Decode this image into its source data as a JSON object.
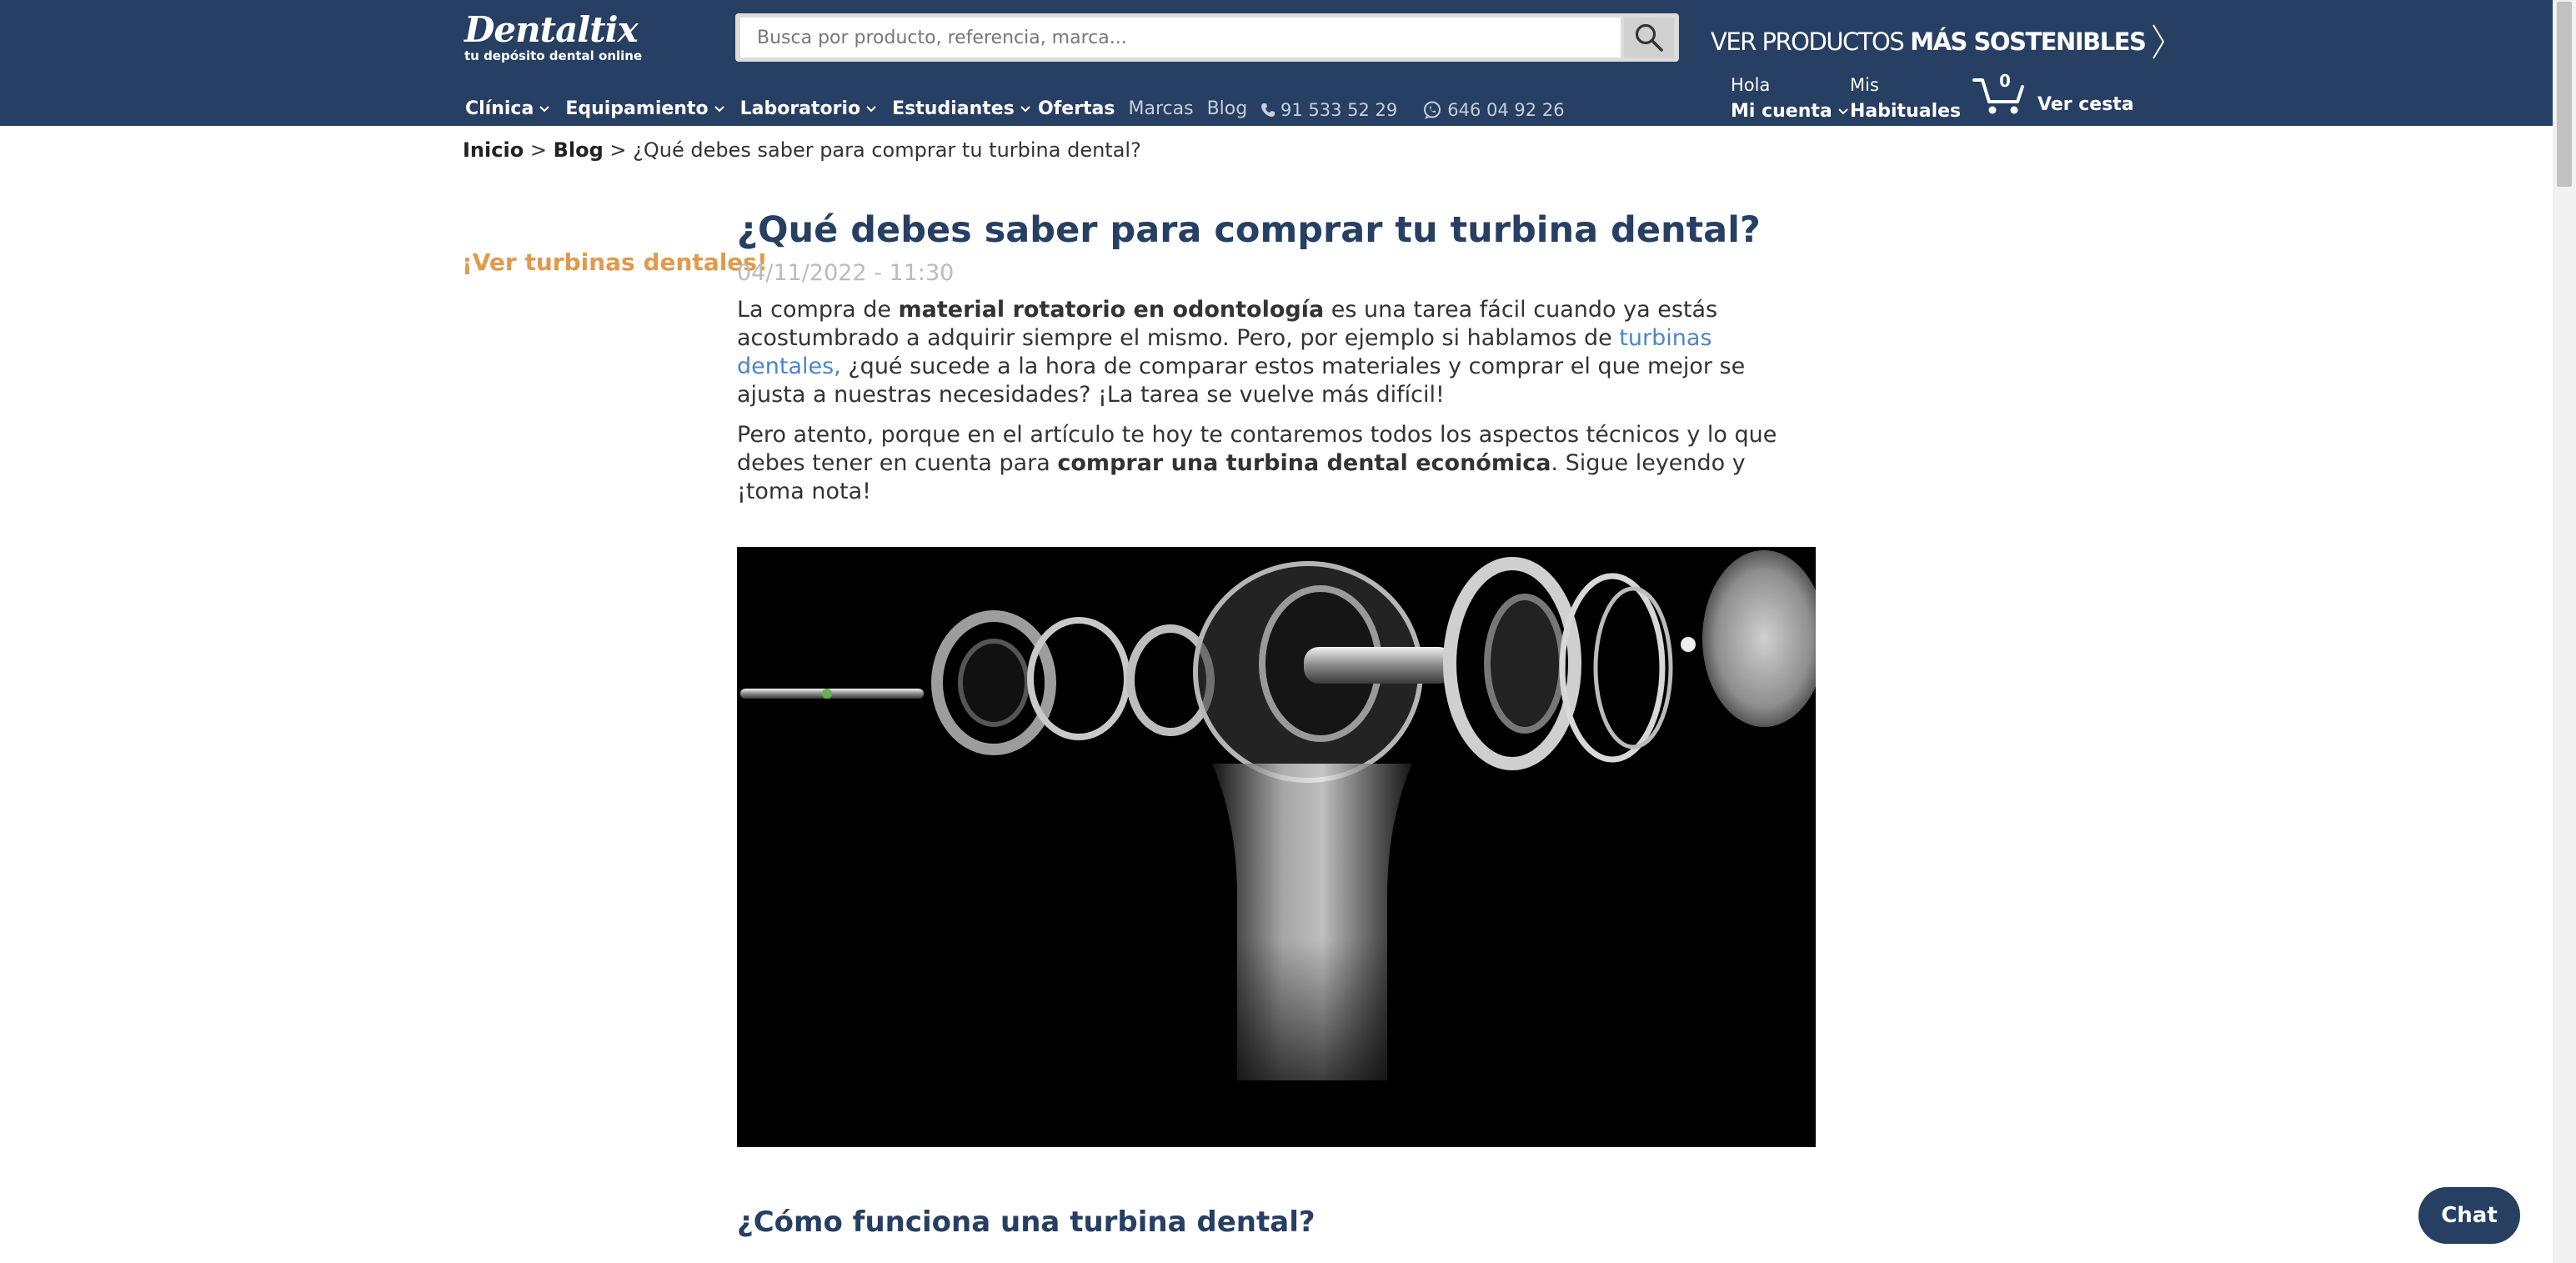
{
  "header": {
    "logo_name": "Dentaltix",
    "logo_tagline": "tu depósito dental online",
    "search_placeholder": "Busca por producto, referencia, marca...",
    "promo_prefix": "VER PRODUCTOS",
    "promo_strong": "MÁS SOSTENIBLES",
    "nav": [
      "Clínica",
      "Equipamiento",
      "Laboratorio",
      "Estudiantes"
    ],
    "ofertas": "Ofertas",
    "marcas": "Marcas",
    "blog": "Blog",
    "phone": "91 533 52 29",
    "whatsapp": "646 04 92 26",
    "account_greeting": "Hola",
    "account_label": "Mi cuenta",
    "habituales_top": "Mis",
    "habituales_label": "Habituales",
    "cart_count": "0",
    "cart_label": "Ver cesta",
    "colors": {
      "header_bg": "#263f63",
      "accent_orange": "#e09a4a",
      "link_blue": "#4b86c8"
    }
  },
  "breadcrumb": {
    "home": "Inicio",
    "sep1": " > ",
    "blog": "Blog",
    "sep2": " > ",
    "current": "¿Qué debes saber para comprar tu turbina dental?"
  },
  "aside": {
    "link": "¡Ver turbinas dentales!"
  },
  "article": {
    "title": "¿Qué debes saber para comprar tu turbina dental?",
    "date": "04/11/2022 - 11:30",
    "p1_a": "La compra de ",
    "p1_b": "material rotatorio en odontología",
    "p1_c": " es una tarea fácil cuando ya estás acostumbrado a adquirir siempre el mismo. Pero, por ejemplo si hablamos de ",
    "p1_link": "turbinas dentales,",
    "p1_d": " ¿qué sucede a la hora de comparar estos materiales y comprar el que mejor se ajusta a nuestras necesidades? ¡La tarea se vuelve más difícil!",
    "p2_a": "Pero atento, porque en el artículo te hoy te contaremos todos los aspectos técnicos y lo que debes tener en cuenta para ",
    "p2_b": "comprar una turbina dental económica",
    "p2_c": ". Sigue leyendo y ¡toma nota!",
    "h2": "¿Cómo funciona una turbina dental?"
  },
  "chat": {
    "label": "Chat"
  }
}
